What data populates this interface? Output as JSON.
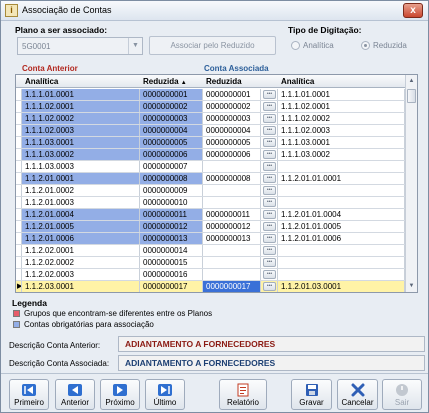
{
  "window": {
    "title": "Associação de Contas",
    "close_label": "x"
  },
  "plano": {
    "label": "Plano a ser associado:",
    "value": "5G0001",
    "assoc_button": "Associar pelo Reduzido"
  },
  "tipo": {
    "label": "Tipo de Digitação:",
    "options": [
      "Analítica",
      "Reduzida"
    ],
    "selected": "Reduzida"
  },
  "sections": {
    "left": "Conta Anterior",
    "right": "Conta Associada"
  },
  "grid": {
    "headers": [
      "Analítica",
      "Reduzida",
      "Reduzida",
      "Analítica"
    ],
    "sort_indicator": "▲",
    "rows": [
      {
        "an1": "1.1.1.01.0001",
        "red1": "0000000001",
        "red2": "0000000001",
        "an2": "1.1.1.01.0001",
        "hl": true
      },
      {
        "an1": "1.1.1.02.0001",
        "red1": "0000000002",
        "red2": "0000000002",
        "an2": "1.1.1.02.0001",
        "hl": true
      },
      {
        "an1": "1.1.1.02.0002",
        "red1": "0000000003",
        "red2": "0000000003",
        "an2": "1.1.1.02.0002",
        "hl": true
      },
      {
        "an1": "1.1.1.02.0003",
        "red1": "0000000004",
        "red2": "0000000004",
        "an2": "1.1.1.02.0003",
        "hl": true
      },
      {
        "an1": "1.1.1.03.0001",
        "red1": "0000000005",
        "red2": "0000000005",
        "an2": "1.1.1.03.0001",
        "hl": true
      },
      {
        "an1": "1.1.1.03.0002",
        "red1": "0000000006",
        "red2": "0000000006",
        "an2": "1.1.1.03.0002",
        "hl": true
      },
      {
        "an1": "1.1.1.03.0003",
        "red1": "0000000007",
        "red2": "",
        "an2": "",
        "hl": false
      },
      {
        "an1": "1.1.2.01.0001",
        "red1": "0000000008",
        "red2": "0000000008",
        "an2": "1.1.2.01.01.0001",
        "hl": true
      },
      {
        "an1": "1.1.2.01.0002",
        "red1": "0000000009",
        "red2": "",
        "an2": "",
        "hl": false
      },
      {
        "an1": "1.1.2.01.0003",
        "red1": "0000000010",
        "red2": "",
        "an2": "",
        "hl": false
      },
      {
        "an1": "1.1.2.01.0004",
        "red1": "0000000011",
        "red2": "0000000011",
        "an2": "1.1.2.01.01.0004",
        "hl": true
      },
      {
        "an1": "1.1.2.01.0005",
        "red1": "0000000012",
        "red2": "0000000012",
        "an2": "1.1.2.01.01.0005",
        "hl": true
      },
      {
        "an1": "1.1.2.01.0006",
        "red1": "0000000013",
        "red2": "0000000013",
        "an2": "1.1.2.01.01.0006",
        "hl": true
      },
      {
        "an1": "1.1.2.02.0001",
        "red1": "0000000014",
        "red2": "",
        "an2": "",
        "hl": false
      },
      {
        "an1": "1.1.2.02.0002",
        "red1": "0000000015",
        "red2": "",
        "an2": "",
        "hl": false
      },
      {
        "an1": "1.1.2.02.0003",
        "red1": "0000000016",
        "red2": "",
        "an2": "",
        "hl": false
      },
      {
        "an1": "1.1.2.03.0001",
        "red1": "0000000017",
        "red2": "0000000017",
        "an2": "1.1.2.01.03.0001",
        "hl": false,
        "selected": true
      }
    ]
  },
  "legend": {
    "title": "Legenda",
    "items": [
      {
        "label": "Grupos que encontram-se diferentes entre os Planos",
        "color": "#e85c6a"
      },
      {
        "label": "Contas obrigatórias para associação",
        "color": "#93aee6"
      }
    ]
  },
  "descriptions": {
    "anterior_label": "Descrição Conta Anterior:",
    "anterior_value": "ADIANTAMENTO A FORNECEDORES",
    "anterior_color": "#8b1a12",
    "associada_label": "Descrição Conta Associada:",
    "associada_value": "ADIANTAMENTO A FORNECEDORES",
    "associada_color": "#1c3f73"
  },
  "toolbar": {
    "primeiro": "Primeiro",
    "anterior": "Anterior",
    "proximo": "Próximo",
    "ultimo": "Último",
    "relatorio": "Relatório",
    "gravar": "Gravar",
    "cancelar": "Cancelar",
    "sair": "Sair"
  }
}
